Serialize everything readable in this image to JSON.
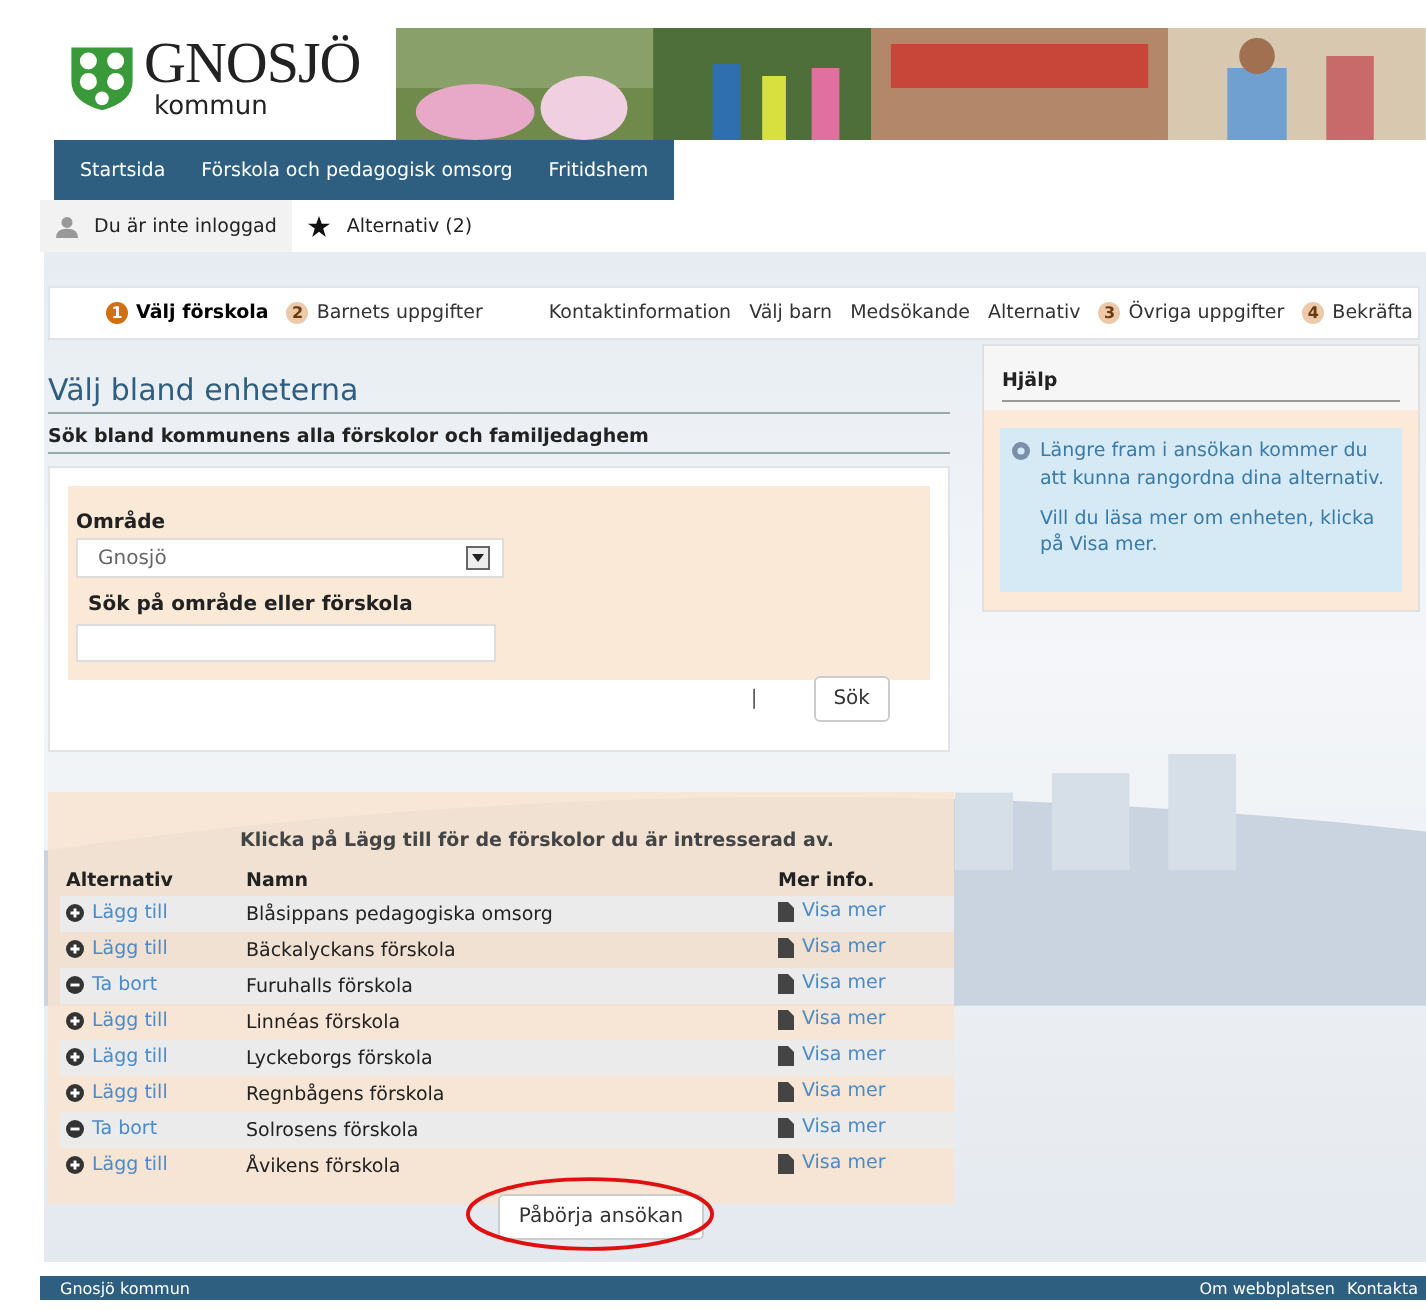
{
  "header": {
    "logo_name": "GNOSJÖ",
    "logo_sub": "kommun"
  },
  "nav": [
    {
      "label": "Startsida"
    },
    {
      "label": "Förskola och pedagogisk omsorg"
    },
    {
      "label": "Fritidshem"
    }
  ],
  "user_bar": [
    {
      "kind": "user",
      "label": "Du är inte inloggad"
    },
    {
      "kind": "star",
      "label": "Alternativ (2)"
    }
  ],
  "steps": [
    {
      "number": "1",
      "label": "Välj förskola",
      "selected": true
    },
    {
      "number": "2",
      "label": "Barnets uppgifter",
      "selected": false
    },
    {
      "label": "Kontaktinformation",
      "selected": false
    },
    {
      "label": "Välj barn",
      "selected": false
    },
    {
      "label": "Medsökande",
      "selected": false
    },
    {
      "label": "Alternativ",
      "selected": false
    },
    {
      "number": "3",
      "label": "Övriga uppgifter",
      "selected": false
    },
    {
      "number": "4",
      "label": "Bekräfta",
      "selected": false
    }
  ],
  "main": {
    "title": "Välj bland enheterna",
    "subtitle": "Sök bland kommunens alla förskolor och familjedaghem",
    "area_label": "Område",
    "area_value": "Gnosjö",
    "search_label": "Sök på område eller förskola",
    "search_marker": "|",
    "search_button": "Sök"
  },
  "help": {
    "title": "Hjälp",
    "paragraphs": [
      "Längre fram i ansökan kommer du att kunna rangordna dina alternativ.",
      "Vill du läsa mer om enheten, klicka på Visa mer."
    ]
  },
  "units": {
    "instruction": "Klicka på Lägg till för de förskolor du är intresserad av.",
    "columns": [
      "Alternativ",
      "Namn",
      "Mer info."
    ],
    "rows": [
      {
        "kind": "add",
        "action": "Lägg till",
        "name": "Blåsippans pedagogiska omsorg",
        "info": "Visa mer"
      },
      {
        "kind": "add",
        "action": "Lägg till",
        "name": "Bäckalyckans förskola",
        "info": "Visa mer"
      },
      {
        "kind": "remove",
        "action": "Ta bort",
        "name": "Furuhalls förskola",
        "info": "Visa mer"
      },
      {
        "kind": "add",
        "action": "Lägg till",
        "name": "Linnéas förskola",
        "info": "Visa mer"
      },
      {
        "kind": "add",
        "action": "Lägg till",
        "name": "Lyckeborgs förskola",
        "info": "Visa mer"
      },
      {
        "kind": "add",
        "action": "Lägg till",
        "name": "Regnbågens förskola",
        "info": "Visa mer"
      },
      {
        "kind": "remove",
        "action": "Ta bort",
        "name": "Solrosens förskola",
        "info": "Visa mer"
      },
      {
        "kind": "add",
        "action": "Lägg till",
        "name": "Åvikens förskola",
        "info": "Visa mer"
      }
    ]
  },
  "start_button": {
    "label": "Påbörja ansökan",
    "highlighted": true
  },
  "footer": {
    "left": "Gnosjö kommun",
    "links": [
      "Om webbplatsen",
      "Kontakta"
    ]
  }
}
